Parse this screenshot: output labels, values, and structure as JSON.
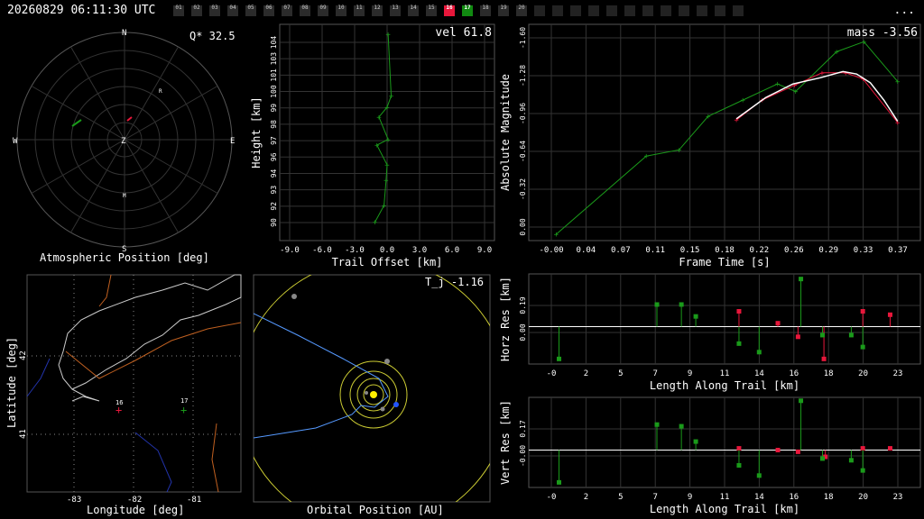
{
  "header": {
    "timestamp": "20260829 06:11:30 UTC",
    "menu_label": "...",
    "cameras": [
      {
        "label": "01",
        "state": "idle"
      },
      {
        "label": "02",
        "state": "idle"
      },
      {
        "label": "03",
        "state": "idle"
      },
      {
        "label": "04",
        "state": "idle"
      },
      {
        "label": "05",
        "state": "idle"
      },
      {
        "label": "06",
        "state": "idle"
      },
      {
        "label": "07",
        "state": "idle"
      },
      {
        "label": "08",
        "state": "idle"
      },
      {
        "label": "09",
        "state": "idle"
      },
      {
        "label": "10",
        "state": "idle"
      },
      {
        "label": "11",
        "state": "idle"
      },
      {
        "label": "12",
        "state": "idle"
      },
      {
        "label": "13",
        "state": "idle"
      },
      {
        "label": "14",
        "state": "idle"
      },
      {
        "label": "15",
        "state": "idle"
      },
      {
        "label": "16",
        "state": "red"
      },
      {
        "label": "17",
        "state": "green"
      },
      {
        "label": "18",
        "state": "idle"
      },
      {
        "label": "19",
        "state": "idle"
      },
      {
        "label": "20",
        "state": "idle"
      },
      {
        "label": "",
        "state": "off"
      },
      {
        "label": "",
        "state": "off"
      },
      {
        "label": "",
        "state": "off"
      },
      {
        "label": "",
        "state": "off"
      },
      {
        "label": "",
        "state": "off"
      },
      {
        "label": "",
        "state": "off"
      },
      {
        "label": "",
        "state": "off"
      },
      {
        "label": "",
        "state": "off"
      },
      {
        "label": "",
        "state": "off"
      },
      {
        "label": "",
        "state": "off"
      },
      {
        "label": "",
        "state": "off"
      },
      {
        "label": "",
        "state": "off"
      }
    ]
  },
  "colors": {
    "station_a": "#e8173b",
    "station_b": "#1a9a1a",
    "grid": "#333333",
    "fit": "#ffffff",
    "sun": "#ffee00",
    "orbit": "#cccc33",
    "earth": "#2255ff"
  },
  "sky": {
    "title": "Atmospheric Position [deg]",
    "q_label": "Q* 32.5",
    "dirs": {
      "n": "N",
      "s": "S",
      "e": "E",
      "w": "W",
      "z": "Z"
    },
    "markers": {
      "r": "R",
      "m": "M"
    }
  },
  "map": {
    "xlabel": "Longitude [deg]",
    "ylabel": "Latitude [deg]",
    "xticks": [
      "-83",
      "-82",
      "-81"
    ],
    "yticks": [
      "42",
      "41"
    ],
    "stations": [
      {
        "label": "16"
      },
      {
        "label": "17"
      }
    ]
  },
  "orbit": {
    "title": "Orbital Position [AU]",
    "tj_label": "T_j -1.16"
  },
  "chart_data": [
    {
      "id": "height",
      "type": "line",
      "title": "",
      "value_label": "vel 61.8",
      "xlabel": "Trail Offset [km]",
      "ylabel": "Height [km]",
      "xlim": [
        -10.5,
        10.5
      ],
      "ylim": [
        89.3,
        104.7
      ],
      "xticks": [
        "-9.0",
        "-6.0",
        "-3.0",
        "0.0",
        "3.0",
        "6.0",
        "9.0"
      ],
      "yticks": [
        "90",
        "92",
        "93",
        "94",
        "96",
        "97",
        "98",
        "99",
        "100",
        "101",
        "103",
        "104"
      ],
      "series": [
        {
          "points": [
            [
              0.1,
              104
            ],
            [
              0.4,
              99.6
            ],
            [
              0.0,
              98.8
            ],
            [
              -0.8,
              98.1
            ],
            [
              0.1,
              96.5
            ],
            [
              -1.0,
              96.1
            ],
            [
              0.0,
              94.7
            ],
            [
              -0.1,
              93.6
            ],
            [
              -0.3,
              91.8
            ],
            [
              -1.2,
              90.6
            ]
          ]
        }
      ]
    },
    {
      "id": "magnitude",
      "type": "line",
      "title": "",
      "value_label": "mass -3.56",
      "xlabel": "Frame Time [s]",
      "ylabel": "Absolute Magnitude",
      "xlim": [
        -0.03,
        0.4
      ],
      "ylim": [
        0.05,
        -1.69
      ],
      "xticks": [
        "-0.00",
        "0.04",
        "0.07",
        "0.11",
        "0.15",
        "0.18",
        "0.22",
        "0.26",
        "0.29",
        "0.33",
        "0.37"
      ],
      "yticks": [
        "0.00",
        "-0.32",
        "-0.64",
        "-0.96",
        "-1.28",
        "-1.60"
      ],
      "series": [
        {
          "points": [
            [
              0.0,
              0.0
            ],
            [
              0.099,
              -0.63
            ],
            [
              0.135,
              -0.68
            ],
            [
              0.167,
              -0.95
            ],
            [
              0.205,
              -1.08
            ],
            [
              0.243,
              -1.21
            ],
            [
              0.263,
              -1.15
            ],
            [
              0.308,
              -1.47
            ],
            [
              0.338,
              -1.55
            ],
            [
              0.375,
              -1.23
            ]
          ]
        },
        {
          "points": [
            [
              0.198,
              -0.92
            ],
            [
              0.226,
              -1.08
            ],
            [
              0.262,
              -1.2
            ],
            [
              0.292,
              -1.3
            ],
            [
              0.318,
              -1.3
            ],
            [
              0.337,
              -1.25
            ],
            [
              0.375,
              -0.9
            ]
          ]
        }
      ],
      "fit": [
        [
          0.198,
          -0.93
        ],
        [
          0.23,
          -1.1
        ],
        [
          0.26,
          -1.21
        ],
        [
          0.29,
          -1.26
        ],
        [
          0.315,
          -1.31
        ],
        [
          0.33,
          -1.29
        ],
        [
          0.345,
          -1.22
        ],
        [
          0.36,
          -1.08
        ],
        [
          0.375,
          -0.91
        ]
      ]
    },
    {
      "id": "horz_res",
      "type": "scatter",
      "xlabel": "Length Along Trail [km]",
      "ylabel": "Horz Res [km]",
      "xlim": [
        -2.2,
        25
      ],
      "ylim": [
        -0.22,
        0.31
      ],
      "xticks": [
        "-0",
        "2",
        "5",
        "7",
        "9",
        "11",
        "14",
        "16",
        "18",
        "20",
        "23"
      ],
      "yticks": [
        "0.00",
        "0.19"
      ],
      "series": [
        {
          "points": [
            [
              12.4,
              0.09
            ],
            [
              15.1,
              0.02
            ],
            [
              16.5,
              -0.06
            ],
            [
              18.3,
              -0.19
            ],
            [
              21.0,
              0.09
            ],
            [
              22.9,
              0.07
            ]
          ]
        },
        {
          "points": [
            [
              -0.1,
              -0.19
            ],
            [
              6.7,
              0.13
            ],
            [
              8.4,
              0.13
            ],
            [
              9.4,
              0.06
            ],
            [
              12.4,
              -0.1
            ],
            [
              13.8,
              -0.15
            ],
            [
              16.7,
              0.28
            ],
            [
              18.2,
              -0.05
            ],
            [
              20.2,
              -0.05
            ],
            [
              21.0,
              -0.12
            ]
          ]
        }
      ]
    },
    {
      "id": "vert_res",
      "type": "scatter",
      "xlabel": "Length Along Trail [km]",
      "ylabel": "Vert Res [km]",
      "xlim": [
        -2.2,
        25
      ],
      "ylim": [
        -0.22,
        0.31
      ],
      "xticks": [
        "-0",
        "2",
        "5",
        "7",
        "9",
        "11",
        "14",
        "16",
        "18",
        "20",
        "23"
      ],
      "yticks": [
        "-0.00",
        "0.17"
      ],
      "series": [
        {
          "points": [
            [
              12.4,
              0.01
            ],
            [
              15.1,
              0.0
            ],
            [
              16.5,
              -0.01
            ],
            [
              18.4,
              -0.04
            ],
            [
              21.0,
              0.01
            ],
            [
              22.9,
              0.01
            ]
          ]
        },
        {
          "points": [
            [
              -0.1,
              -0.19
            ],
            [
              6.7,
              0.15
            ],
            [
              8.4,
              0.14
            ],
            [
              9.4,
              0.05
            ],
            [
              12.4,
              -0.09
            ],
            [
              13.8,
              -0.15
            ],
            [
              16.7,
              0.29
            ],
            [
              18.2,
              -0.05
            ],
            [
              20.2,
              -0.06
            ],
            [
              21.0,
              -0.12
            ]
          ]
        }
      ]
    }
  ]
}
